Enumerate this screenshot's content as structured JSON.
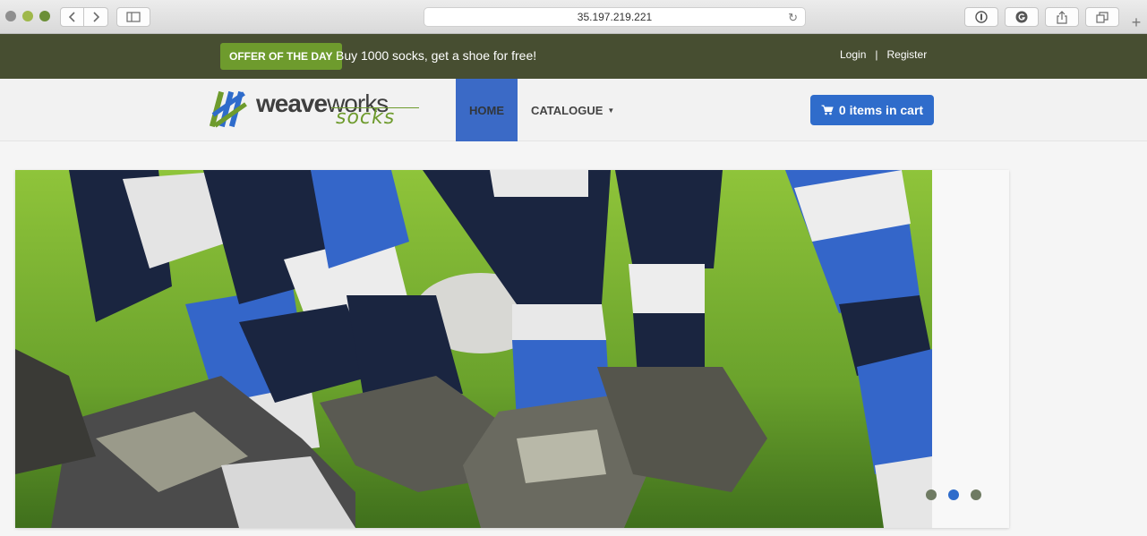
{
  "browser": {
    "url": "35.197.219.221",
    "back_icon": "chevron-left-icon",
    "forward_icon": "chevron-right-icon",
    "sidebar_icon": "sidebar-icon",
    "reload_icon": "reload-icon",
    "extension_icons": [
      "onepassword-icon",
      "grammarly-icon",
      "share-icon",
      "tabs-icon"
    ],
    "new_tab_label": "+"
  },
  "topbar": {
    "offer_badge": "OFFER OF THE DAY",
    "offer_text": "Buy 1000 socks, get a shoe for free!",
    "login": "Login",
    "separator": "|",
    "register": "Register"
  },
  "navbar": {
    "logo_word": "weave",
    "logo_word2": "works",
    "logo_sub": "socks",
    "home": "HOME",
    "catalogue": "CATALOGUE",
    "cart": "0 items in cart"
  },
  "carousel": {
    "slide_count": 3,
    "active_index": 1
  },
  "colors": {
    "topbar_bg": "#474e31",
    "accent_green": "#6e9b2d",
    "accent_blue": "#2f6ccb"
  }
}
